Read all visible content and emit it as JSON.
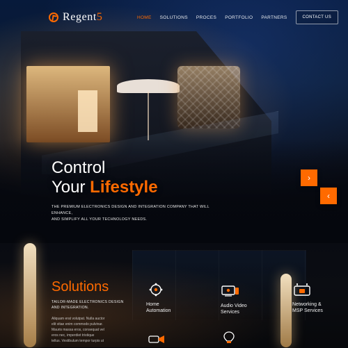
{
  "header": {
    "logo_text": "Regent",
    "logo_number": "5",
    "nav": {
      "items": [
        {
          "label": "HOME",
          "active": true
        },
        {
          "label": "SOLUTIONS",
          "active": false
        },
        {
          "label": "PROCES",
          "active": false
        },
        {
          "label": "PORTFOLIO",
          "active": false
        },
        {
          "label": "PARTNERS",
          "active": false
        }
      ],
      "contact_label": "CONTACT US"
    }
  },
  "hero": {
    "line1": "Control",
    "line2_prefix": "Your ",
    "line2_highlight": "Lifestyle",
    "subtext_line1": "THE PREMIUM ELECTRONICS DESIGN AND INTEGRATION  COMPANY THAT WILL ENHANCE,",
    "subtext_line2": "AND SIMPLIFY ALL YOUR  TECHNOLOGY NEEDS.",
    "arrow_next_icon": "chevron-right-icon",
    "arrow_prev_icon": "chevron-left-icon",
    "accent_color": "#ff6a00"
  },
  "solutions": {
    "title": "Solutions",
    "subtitle_line1": "TAILOR-MADE ELECTRONICS DESIGN",
    "subtitle_line2": "AND INTEGRATION.",
    "paragraph_lines": [
      "Aliquam erat volutpat. Nulla auctor",
      "elit vitae enim commodo pulvinar.",
      "Mauris massa eros, consequat vel",
      "eros nec, imperdiet tristique",
      "tellus. Vestibulum tempor turpis ut"
    ],
    "services": [
      {
        "label_line1": "Home",
        "label_line2": "Automation",
        "icon": "home-automation-icon"
      },
      {
        "label_line1": "Audio Video",
        "label_line2": "Services",
        "icon": "audio-video-icon"
      },
      {
        "label_line1": "Networking &",
        "label_line2": "MSP Services",
        "icon": "networking-icon"
      }
    ],
    "partial_icons": [
      "camera-icon",
      "lightbulb-icon"
    ]
  }
}
